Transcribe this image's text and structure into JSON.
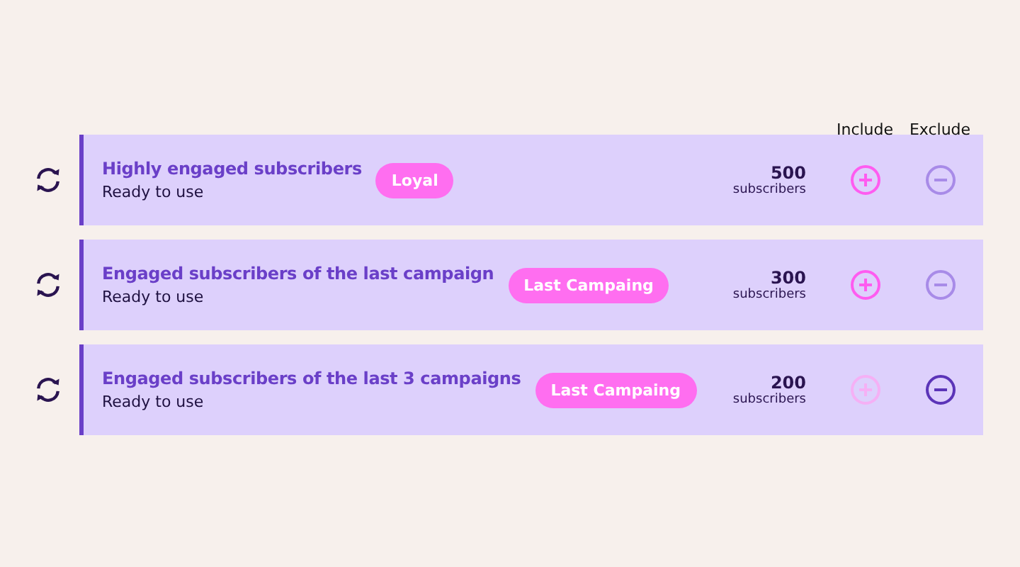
{
  "columns": {
    "include": "Include",
    "exclude": "Exclude"
  },
  "segments": [
    {
      "title": "Highly engaged subscribers",
      "status": "Ready to use",
      "tag": "Loyal",
      "count": "500",
      "unit": "subscribers",
      "include_disabled": false,
      "exclude_selected": false
    },
    {
      "title": "Engaged subscribers of the last campaign",
      "status": "Ready to use",
      "tag": "Last Campaing",
      "count": "300",
      "unit": "subscribers",
      "include_disabled": false,
      "exclude_selected": false
    },
    {
      "title": "Engaged subscribers of the last 3 campaigns",
      "status": "Ready to use",
      "tag": "Last Campaing",
      "count": "200",
      "unit": "subscribers",
      "include_disabled": true,
      "exclude_selected": true
    }
  ]
}
